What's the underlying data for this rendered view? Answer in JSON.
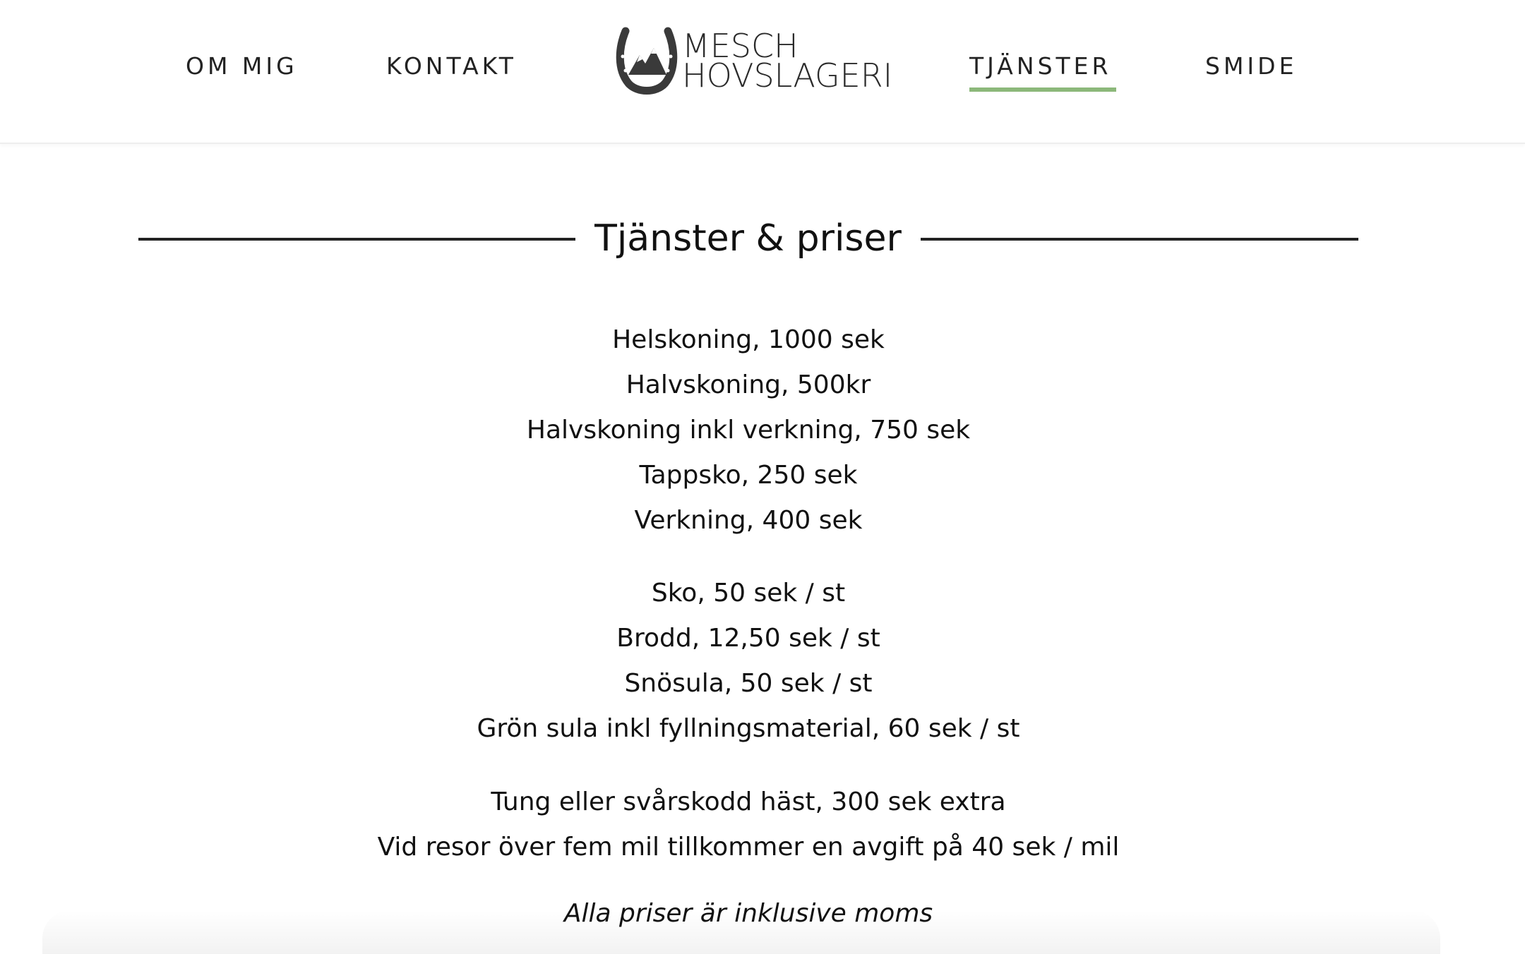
{
  "nav": {
    "left": [
      {
        "label": "OM MIG"
      },
      {
        "label": "KONTAKT"
      }
    ],
    "right": [
      {
        "label": "TJÄNSTER",
        "active": true
      },
      {
        "label": "SMIDE"
      }
    ],
    "active_color": "#8cb87a"
  },
  "logo": {
    "line1": "MESCH",
    "line2": "HOVSLAGERI",
    "icon": "horseshoe-mountain-icon"
  },
  "section": {
    "title": "Tjänster & priser"
  },
  "prices": {
    "group1": [
      "Helskoning, 1000 sek",
      "Halvskoning, 500kr",
      "Halvskoning inkl verkning, 750 sek",
      "Tappsko, 250 sek",
      "Verkning, 400 sek"
    ],
    "group2": [
      "Sko, 50 sek / st",
      "Brodd, 12,50 sek / st",
      "Snösula, 50 sek / st",
      "Grön sula inkl fyllningsmaterial, 60 sek / st"
    ],
    "group3": [
      "Tung eller svårskodd häst, 300 sek extra",
      "Vid resor över fem mil tillkommer en avgift på 40 sek / mil"
    ],
    "vat_note": "Alla priser är inklusive moms"
  }
}
